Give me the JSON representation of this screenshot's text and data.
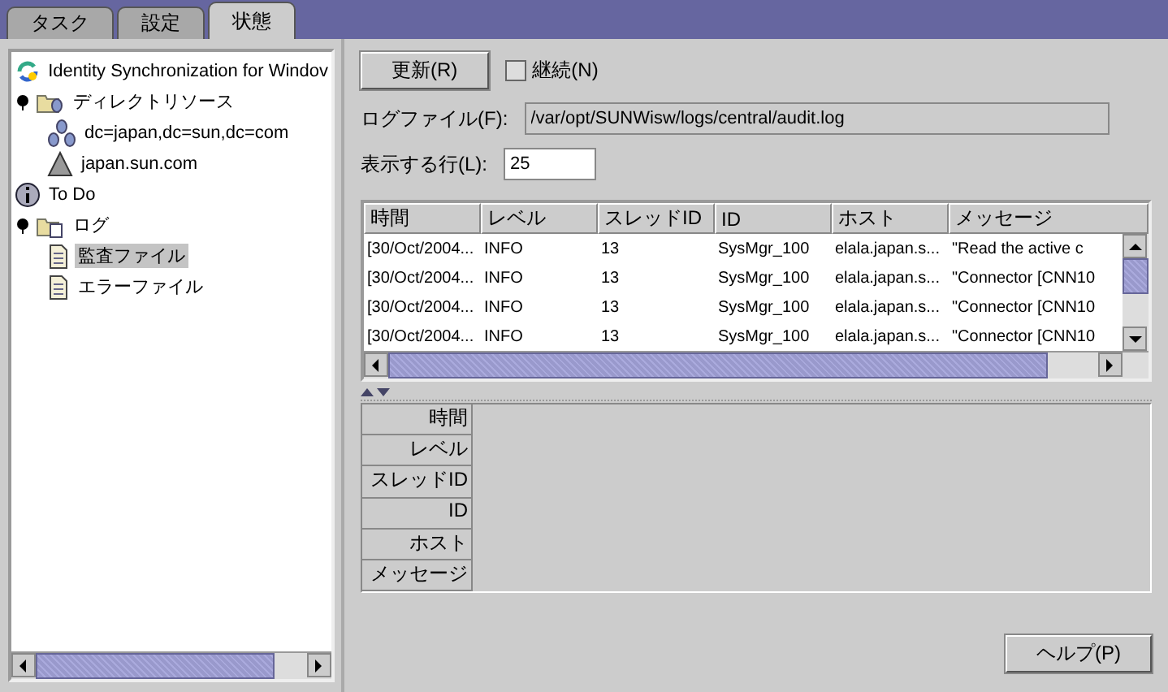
{
  "tabs": [
    {
      "label": "タスク",
      "selected": false
    },
    {
      "label": "設定",
      "selected": false
    },
    {
      "label": "状態",
      "selected": true
    }
  ],
  "tree": [
    {
      "label": "Identity Synchronization for Windov",
      "kind": "root",
      "selected": false,
      "children": [
        {
          "label": "ディレクトリソース",
          "kind": "folder",
          "selected": false,
          "expanded": true,
          "children": [
            {
              "label": "dc=japan,dc=sun,dc=com",
              "kind": "database",
              "selected": false
            },
            {
              "label": "japan.sun.com",
              "kind": "server",
              "selected": false
            }
          ]
        },
        {
          "label": "To Do",
          "kind": "info",
          "selected": false
        },
        {
          "label": "ログ",
          "kind": "log-folder",
          "selected": false,
          "expanded": true,
          "children": [
            {
              "label": "監査ファイル",
              "kind": "file",
              "selected": true
            },
            {
              "label": "エラーファイル",
              "kind": "file",
              "selected": false
            }
          ]
        }
      ]
    }
  ],
  "refresh_button": "更新(R)",
  "continuous": {
    "label": "継続(N)",
    "checked": false
  },
  "log_file": {
    "label": "ログファイル(F):",
    "value": "/var/opt/SUNWisw/logs/central/audit.log"
  },
  "rows_shown": {
    "label": "表示する行(L):",
    "value": "25"
  },
  "table": {
    "columns": [
      "時間",
      "レベル",
      "スレッドID",
      "ID",
      "ホスト",
      "メッセージ"
    ],
    "rows": [
      [
        "[30/Oct/2004...",
        "INFO",
        "13",
        "SysMgr_100",
        "elala.japan.s...",
        "\"Read the active c"
      ],
      [
        "[30/Oct/2004...",
        "INFO",
        "13",
        "SysMgr_100",
        "elala.japan.s...",
        "\"Connector [CNN10"
      ],
      [
        "[30/Oct/2004...",
        "INFO",
        "13",
        "SysMgr_100",
        "elala.japan.s...",
        "\"Connector [CNN10"
      ],
      [
        "[30/Oct/2004...",
        "INFO",
        "13",
        "SysMgr_100",
        "elala.japan.s...",
        "\"Connector [CNN10"
      ]
    ]
  },
  "details": {
    "labels": [
      "時間",
      "レベル",
      "スレッドID",
      "ID",
      "ホスト",
      "メッセージ"
    ]
  },
  "help_button": "ヘルプ(P)"
}
